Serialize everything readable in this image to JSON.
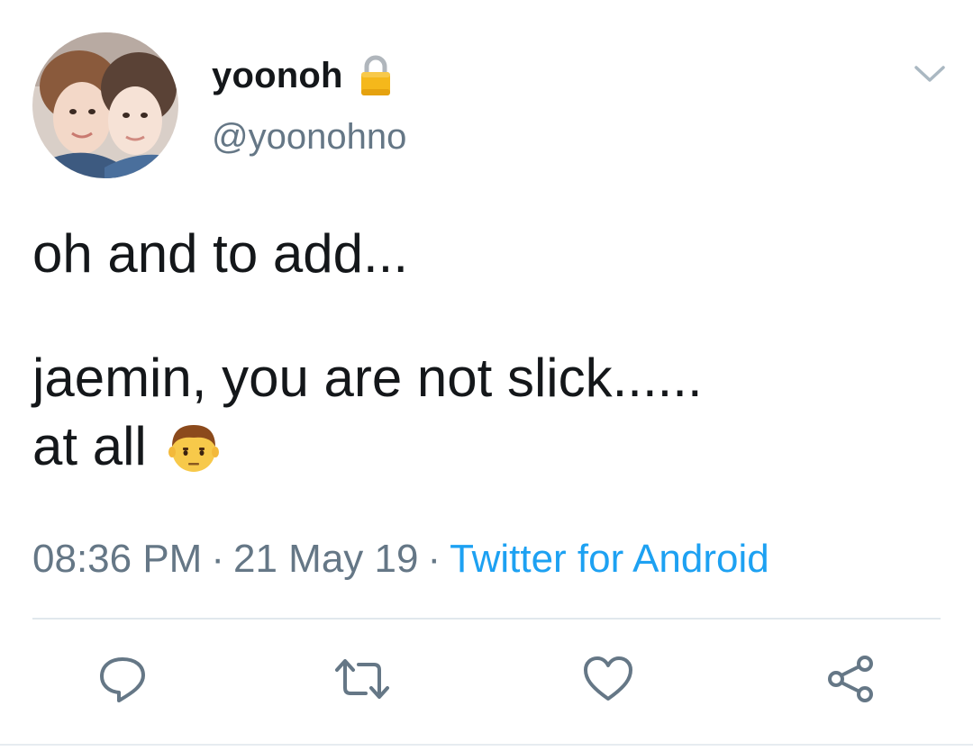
{
  "user": {
    "display_name": "yoonoh",
    "handle": "@yoonohno",
    "protected_icon": "lock-icon",
    "avatar_icon": "avatar-photo"
  },
  "tweet": {
    "line1": "oh and to add...",
    "line2": "jaemin, you are not slick......",
    "line3": "at all",
    "emoji_icon": "man-emoji-icon"
  },
  "meta": {
    "time": "08:36 PM",
    "separator": "·",
    "date": "21 May 19",
    "source": "Twitter for Android"
  },
  "actions": {
    "reply_icon": "reply-icon",
    "retweet_icon": "retweet-icon",
    "like_icon": "heart-icon",
    "share_icon": "share-icon"
  },
  "colors": {
    "text": "#14171a",
    "secondary": "#657786",
    "link": "#1da1f2",
    "icon": "#657786",
    "divider": "#e1e8ed"
  }
}
